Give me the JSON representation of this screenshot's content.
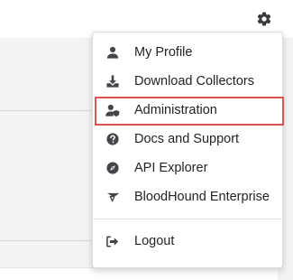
{
  "menu": {
    "items": [
      {
        "label": "My Profile",
        "icon": "user-icon"
      },
      {
        "label": "Download Collectors",
        "icon": "download-icon"
      },
      {
        "label": "Administration",
        "icon": "user-shield-icon"
      },
      {
        "label": "Docs and Support",
        "icon": "question-circle-icon"
      },
      {
        "label": "API Explorer",
        "icon": "compass-icon"
      },
      {
        "label": "BloodHound Enterprise",
        "icon": "bloodhound-logo-icon"
      }
    ],
    "logout": {
      "label": "Logout",
      "icon": "sign-out-icon"
    },
    "highlighted_item": "Administration"
  },
  "header": {
    "settings_icon": "gear-icon"
  },
  "colors": {
    "icon": "#444549",
    "text": "#222326",
    "highlight_border": "#e05353",
    "background": "#f3f3f4"
  }
}
